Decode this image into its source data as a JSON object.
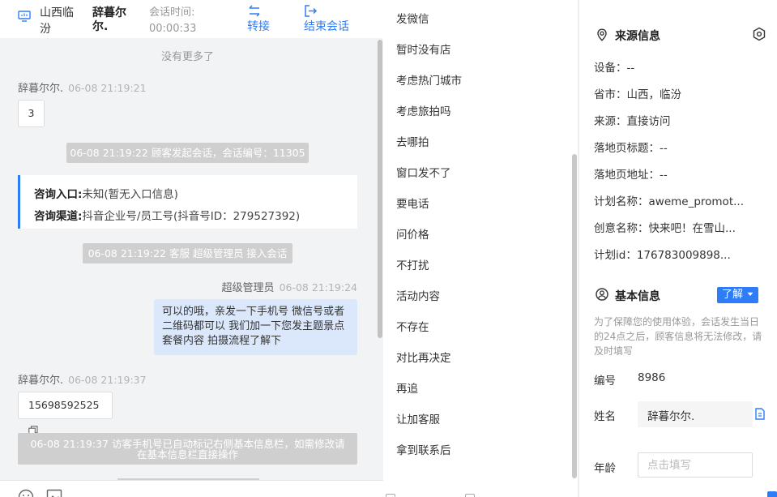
{
  "header": {
    "location": "山西临汾",
    "visitor_name": "辞暮尔尔.",
    "session_time_label": "会话时间:",
    "session_time": "00:00:33",
    "transfer_label": "转接",
    "end_label": "结束会话"
  },
  "chat": {
    "no_more": "没有更多了",
    "messages": [
      {
        "sender": "辞暮尔尔.",
        "time": "06-08 21:19:21",
        "text": "3"
      },
      {
        "system": "06-08 21:19:22 顾客发起会话，会话编号：11305"
      },
      {
        "card": {
          "entry_label": "咨询入口:",
          "entry_value": "未知(暂无入口信息)",
          "channel_label": "咨询渠道:",
          "channel_value": "抖音企业号/员工号(抖音号ID：279527392)"
        }
      },
      {
        "system": "06-08 21:19:22 客服 超级管理员 接入会话"
      },
      {
        "sender": "超级管理员",
        "time": "06-08 21:19:24",
        "text": "可以的哦，亲发一下手机号 微信号或者二维码都可以 我们加一下您发主题景点套餐内容 拍摄流程了解下"
      },
      {
        "sender": "辞暮尔尔.",
        "time": "06-08 21:19:37",
        "text": "15698592525"
      },
      {
        "system": "06-08 21:19:37 访客手机号已自动标记右侧基本信息栏，如需修改请在基本信息栏直接操作"
      }
    ]
  },
  "quick_replies": [
    "发微信",
    "暂时没有店",
    "考虑热门城市",
    "考虑旅拍吗",
    "去哪拍",
    "窗口发不了",
    "要电话",
    "问价格",
    "不打扰",
    "活动内容",
    "不存在",
    "对比再决定",
    "再追",
    "让加客服",
    "拿到联系后"
  ],
  "source_info": {
    "title": "来源信息",
    "rows": [
      "设备：--",
      "省市：山西，临汾",
      "来源：直接访问",
      "落地页标题：--",
      "落地页地址：--",
      "计划名称：aweme_promot...",
      "创意名称：快来吧！在雪山...",
      "计划id：176783009898..."
    ]
  },
  "basic_info": {
    "title": "基本信息",
    "learn_label": "了解",
    "notice": "为了保障您的使用体验，会话发生当日的24点之后，顾客信息将无法修改，请及时填写",
    "id_label": "编号",
    "id_value": "8986",
    "name_label": "姓名",
    "name_value": "辞暮尔尔.",
    "age_label": "年龄",
    "age_placeholder": "点击填写"
  },
  "colors": {
    "accent": "#2e7df6",
    "chat_bg": "#f2f3f5",
    "system_msg": "#cfcfcf",
    "outgoing_bubble": "#dbe8fc"
  }
}
